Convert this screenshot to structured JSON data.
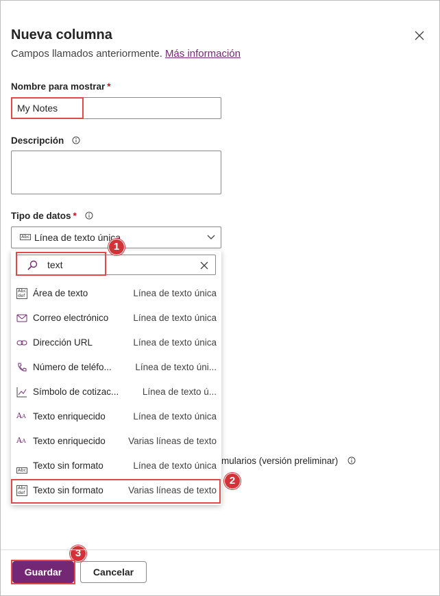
{
  "panel": {
    "title": "Nueva columna",
    "subtitle": "Campos llamados anteriormente.",
    "learn_more": "Más información"
  },
  "fields": {
    "display_name_label": "Nombre para mostrar",
    "display_name_value": "My Notes",
    "description_label": "Descripción",
    "description_value": "",
    "data_type_label": "Tipo de datos",
    "data_type_selected": "Línea de texto única",
    "required_mark": "*"
  },
  "dropdown": {
    "search_value": "text",
    "items": [
      {
        "name": "Área de texto",
        "type": "Línea de texto única",
        "icon": "abc-def-icon"
      },
      {
        "name": "Correo electrónico",
        "type": "Línea de texto única",
        "icon": "mail-icon"
      },
      {
        "name": "Dirección URL",
        "type": "Línea de texto única",
        "icon": "link-icon"
      },
      {
        "name": "Número de teléfo...",
        "type": "Línea de texto úni...",
        "icon": "phone-icon"
      },
      {
        "name": "Símbolo de cotizac...",
        "type": "Línea de texto ú...",
        "icon": "trend-chart-icon"
      },
      {
        "name": "Texto enriquecido",
        "type": "Línea de texto única",
        "icon": "rich-text-icon"
      },
      {
        "name": "Texto enriquecido",
        "type": "Varias líneas de texto",
        "icon": "rich-text-icon"
      },
      {
        "name": "Texto sin formato",
        "type": "Línea de texto única",
        "icon": "abc-icon"
      },
      {
        "name": "Texto sin formato",
        "type": "Varias líneas de texto",
        "icon": "abc-def-icon"
      }
    ]
  },
  "behind": {
    "forms_text": "mularios (versión preliminar)"
  },
  "badges": [
    "1",
    "2",
    "3"
  ],
  "footer": {
    "save": "Guardar",
    "cancel": "Cancelar"
  },
  "colors": {
    "accent": "#742774",
    "highlight": "#e34848",
    "badge": "#d13438"
  }
}
